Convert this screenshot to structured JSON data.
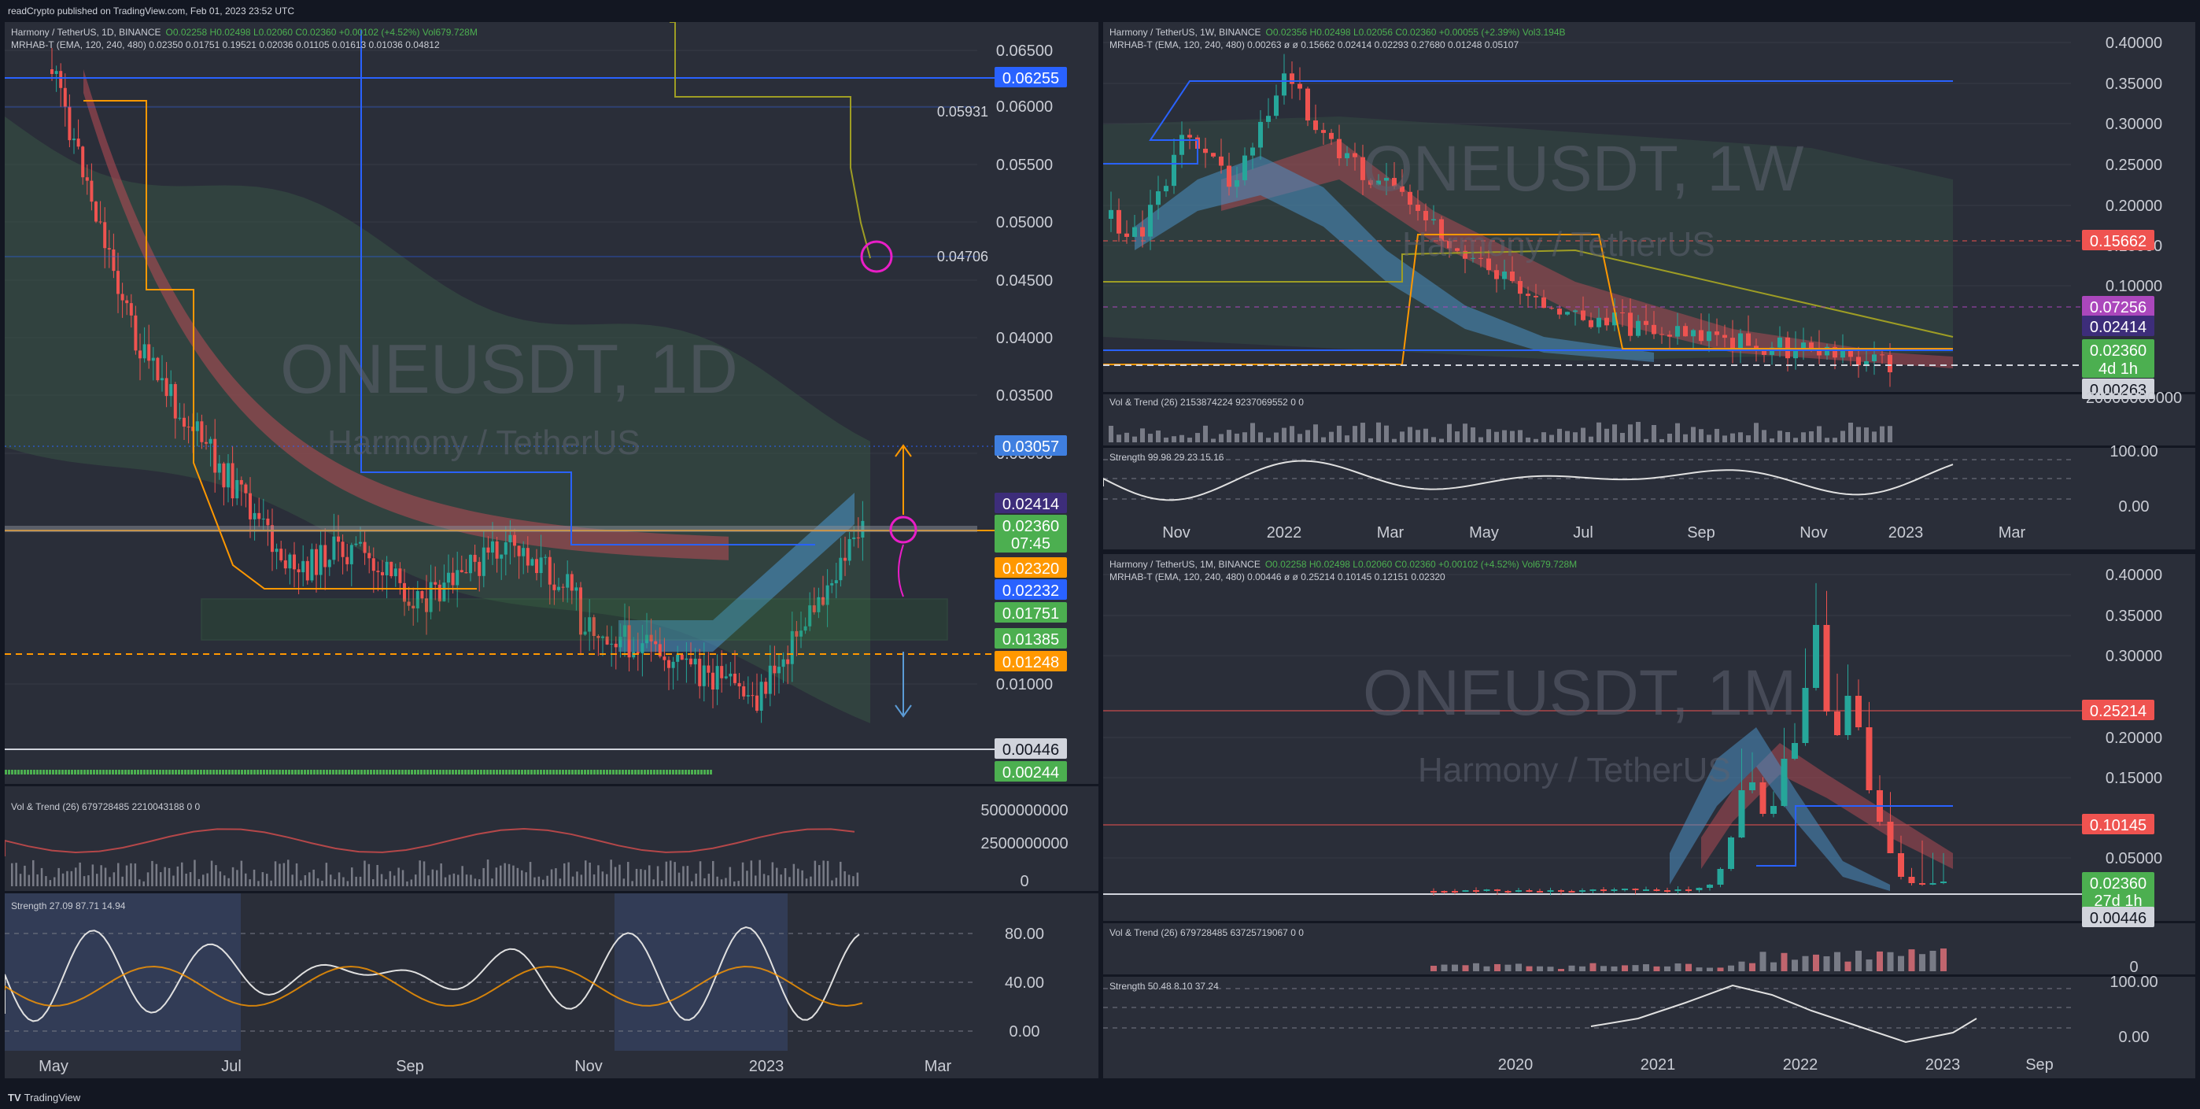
{
  "header": {
    "published_text": "readCrypto published on TradingView.com, Feb 01, 2023 23:52 UTC"
  },
  "footer": {
    "brand": "TradingView"
  },
  "colors": {
    "bg": "#2a2e39",
    "green": "#4caf50",
    "red": "#ef5350",
    "blue": "#2962ff",
    "orange": "#ff9800",
    "purple": "#3d2d7a",
    "magenta": "#e91ec7"
  },
  "daily": {
    "title": "Harmony / TetherUS, 1D, BINANCE",
    "ohlc": "O0.02258 H0.02498 L0.02060 C0.02360 +0.00102 (+4.52%) Vol679.728M",
    "ind": "MRHAB-T (EMA, 120, 240, 480) 0.02350 0.01751 0.19521 0.02036 0.01105 0.01613 0.01036 0.04812",
    "wm_symbol": "ONEUSDT, 1D",
    "wm_name": "Harmony / TetherUS",
    "yticks": [
      "0.06500",
      "0.06000",
      "0.05500",
      "0.05000",
      "0.04500",
      "0.04000",
      "0.03500",
      "0.03000",
      "0.01000"
    ],
    "annot": [
      "0.05931",
      "0.04706"
    ],
    "price_labels": [
      {
        "text": "0.06255",
        "bg": "#2962ff"
      },
      {
        "text": "0.03057",
        "bg": "#3f7fe0"
      },
      {
        "text": "0.02414",
        "bg": "#3d2d7a"
      },
      {
        "text": "0.02360",
        "bg": "#4caf50"
      },
      {
        "text": "07:45",
        "bg": "#4caf50"
      },
      {
        "text": "0.02320",
        "bg": "#ff9800"
      },
      {
        "text": "0.02232",
        "bg": "#2962ff"
      },
      {
        "text": "0.01751",
        "bg": "#4caf50"
      },
      {
        "text": "0.01385",
        "bg": "#4caf50"
      },
      {
        "text": "0.01248",
        "bg": "#ff9800"
      },
      {
        "text": "0.00446",
        "bg": "#d1d4dc"
      },
      {
        "text": "0.00244",
        "bg": "#4caf50"
      }
    ],
    "vol_title": "Vol & Trend (26) 679728485 2210043188 0 0",
    "vol_ticks": [
      "5000000000",
      "2500000000",
      "0"
    ],
    "str_title": "Strength 27.09 87.71 14.94",
    "str_ticks": [
      "80.00",
      "40.00",
      "0.00"
    ],
    "xticks": [
      "May",
      "Jul",
      "Sep",
      "Nov",
      "2023",
      "Mar"
    ]
  },
  "weekly": {
    "title": "Harmony / TetherUS, 1W, BINANCE",
    "ohlc": "O0.02356 H0.02498 L0.02056 C0.02360 +0.00055 (+2.39%) Vol3.194B",
    "ind": "MRHAB-T (EMA, 120, 240, 480) 0.00263 ø ø 0.15662 0.02414 0.02293 0.27680 0.01248 0.05107",
    "wm_symbol": "ONEUSDT, 1W",
    "wm_name": "Harmony / TetherUS",
    "yticks": [
      "0.40000",
      "0.35000",
      "0.30000",
      "0.25000",
      "0.20000",
      "0.15000",
      "0.10000"
    ],
    "price_labels": [
      {
        "text": "0.15662",
        "bg": "#ef5350"
      },
      {
        "text": "0.07256",
        "bg": "#ab47bc"
      },
      {
        "text": "0.02414",
        "bg": "#3d2d7a"
      },
      {
        "text": "0.02360",
        "bg": "#4caf50"
      },
      {
        "text": "4d 1h",
        "bg": "#4caf50"
      },
      {
        "text": "0.00263",
        "bg": "#d1d4dc"
      }
    ],
    "vol_title": "Vol & Trend (26) 2153874224 9237069552 0 0",
    "vol_ticks": [
      "20000000000"
    ],
    "str_title": "Strength 99.98 29.23 15.16",
    "str_ticks": [
      "100.00",
      "0.00"
    ],
    "xticks": [
      "Nov",
      "2022",
      "Mar",
      "May",
      "Jul",
      "Sep",
      "Nov",
      "2023",
      "Mar"
    ]
  },
  "monthly": {
    "title": "Harmony / TetherUS, 1M, BINANCE",
    "ohlc": "O0.02258 H0.02498 L0.02060 C0.02360 +0.00102 (+4.52%) Vol679.728M",
    "ind": "MRHAB-T (EMA, 120, 240, 480) 0.00446 ø ø 0.25214 0.10145 0.12151 0.02320",
    "wm_symbol": "ONEUSDT, 1M",
    "wm_name": "Harmony / TetherUS",
    "yticks": [
      "0.40000",
      "0.35000",
      "0.30000",
      "0.20000",
      "0.15000",
      "0.05000"
    ],
    "price_labels": [
      {
        "text": "0.25214",
        "bg": "#ef5350"
      },
      {
        "text": "0.10145",
        "bg": "#ef5350"
      },
      {
        "text": "0.02360",
        "bg": "#4caf50"
      },
      {
        "text": "27d 1h",
        "bg": "#4caf50"
      },
      {
        "text": "0.00446",
        "bg": "#d1d4dc"
      }
    ],
    "vol_title": "Vol & Trend (26) 679728485 63725719067 0 0",
    "vol_ticks": [
      "0"
    ],
    "str_title": "Strength 50.48 8.10 37.24",
    "str_ticks": [
      "100.00",
      "0.00"
    ],
    "xticks": [
      "2020",
      "2021",
      "2022",
      "2023",
      "Sep"
    ]
  },
  "chart_data": [
    {
      "type": "line",
      "title": "ONEUSDT, 1D",
      "x": [
        "May",
        "Jul",
        "Sep",
        "Nov",
        "2023"
      ],
      "series": [
        {
          "values": [
            0.0625,
            0.017,
            0.022,
            0.017,
            0.0236
          ]
        }
      ],
      "ylim": [
        0.0,
        0.068
      ]
    },
    {
      "type": "line",
      "title": "ONEUSDT, 1W",
      "x": [
        "Nov",
        "2022",
        "Mar",
        "May",
        "Jul",
        "Sep",
        "Nov",
        "2023"
      ],
      "series": [
        {
          "values": [
            0.22,
            0.25,
            0.19,
            0.07,
            0.03,
            0.024,
            0.018,
            0.0236
          ]
        }
      ],
      "ylim": [
        0.0,
        0.42
      ]
    },
    {
      "type": "line",
      "title": "ONEUSDT, 1M",
      "x": [
        "2020",
        "2021",
        "2022",
        "2023"
      ],
      "series": [
        {
          "values": [
            0.01,
            0.08,
            0.22,
            0.0236
          ]
        }
      ],
      "ylim": [
        0.0,
        0.42
      ]
    }
  ]
}
